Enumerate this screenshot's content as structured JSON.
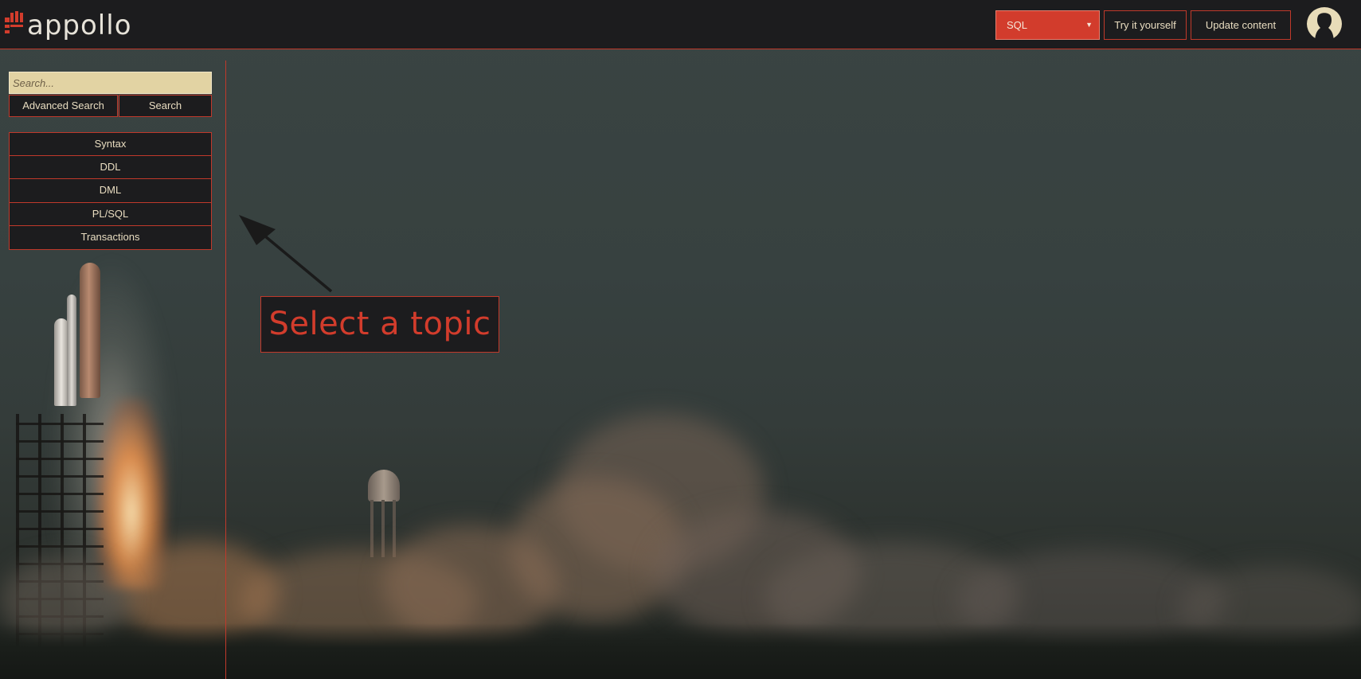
{
  "header": {
    "logo_text": "appollo",
    "language_select": {
      "selected": "SQL"
    },
    "try_button": "Try it yourself",
    "update_button": "Update content"
  },
  "sidebar": {
    "search": {
      "placeholder": "Search...",
      "value": ""
    },
    "advanced_search_button": "Advanced Search",
    "search_button": "Search",
    "topics": [
      "Syntax",
      "DDL",
      "DML",
      "PL/SQL",
      "Transactions"
    ]
  },
  "main": {
    "hint_text": "Select a topic"
  },
  "colors": {
    "accent": "#d23c2c",
    "panel": "#1c1c1e",
    "text": "#e8dcc0",
    "search_bg": "#e2d3a3"
  },
  "icons": {
    "logo": "appollo-logo-icon",
    "avatar": "user-avatar-icon",
    "dropdown": "chevron-down-icon",
    "hint_arrow": "arrow-up-left-icon"
  }
}
